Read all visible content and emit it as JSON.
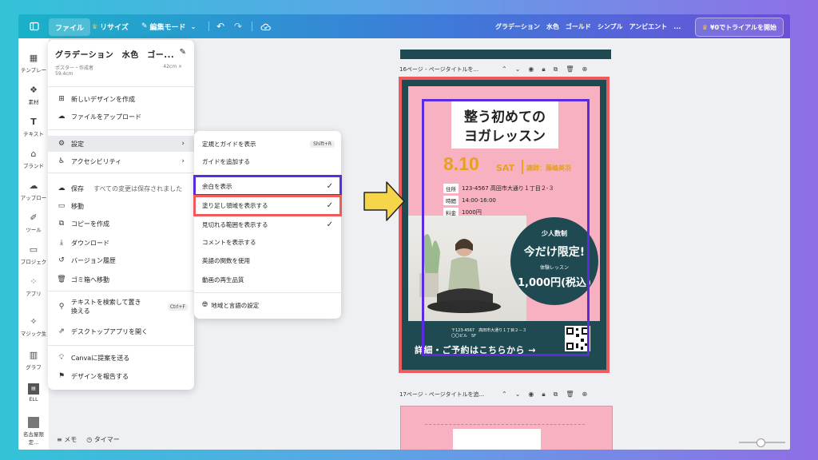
{
  "topbar": {
    "file": "ファイル",
    "resize": "リサイズ",
    "edit_mode": "編集モード",
    "doc_title": "グラデーション　水色　ゴールド　シンプル　アンビエント　...",
    "trial": "¥0でトライアルを開始"
  },
  "rail": [
    {
      "label": "テンプレー",
      "icon": "template-icon"
    },
    {
      "label": "素材",
      "icon": "elements-icon"
    },
    {
      "label": "テキスト",
      "icon": "text-icon"
    },
    {
      "label": "ブランド",
      "icon": "brand-icon"
    },
    {
      "label": "アップロー",
      "icon": "upload-icon"
    },
    {
      "label": "ツール",
      "icon": "tools-icon"
    },
    {
      "label": "プロジェク",
      "icon": "projects-icon"
    },
    {
      "label": "アプリ",
      "icon": "apps-icon"
    },
    {
      "label": "マジック生",
      "icon": "magic-icon"
    },
    {
      "label": "グラフ",
      "icon": "chart-icon"
    },
    {
      "label": "ELL",
      "icon": "ell-icon"
    },
    {
      "label": "名古屋限定...",
      "icon": "folder-icon"
    }
  ],
  "bottom": {
    "notes": "メモ",
    "timer": "タイマー"
  },
  "menu": {
    "title": "グラデーション　水色　ゴー...",
    "meta_left": "ポスター・作成者",
    "meta_right": "42cm ×",
    "meta_size": "59.4cm",
    "items": {
      "new_design": "新しいデザインを作成",
      "upload": "ファイルをアップロード",
      "settings": "設定",
      "accessibility": "アクセシビリティ",
      "save": "保存",
      "save_status": "すべての変更は保存されました",
      "move": "移動",
      "copy": "コピーを作成",
      "download": "ダウンロード",
      "version": "バージョン履歴",
      "trash": "ゴミ箱へ移動",
      "find_1": "テキストを検索して置き",
      "find_2": "換える",
      "find_shortcut": "Ctrl+F",
      "desktop": "デスクトップアプリを開く",
      "suggest": "Canvaに提案を送る",
      "report": "デザインを報告する"
    }
  },
  "submenu": {
    "rulers": "定規とガイドを表示",
    "rulers_shortcut": "Shift+R",
    "add_guide": "ガイドを追加する",
    "margins": "余白を表示",
    "bleed": "塗り足し領域を表示する",
    "cut": "見切れる範囲を表示する",
    "comments": "コメントを表示する",
    "english_fn": "英語の関数を使用",
    "video_quality": "動画の再生品質",
    "region": "地域と言語の設定"
  },
  "pages": {
    "p16": "16ページ - ページタイトルを...",
    "p17": "17ページ - ページタイトルを追..."
  },
  "poster": {
    "title_line1": "整う初めての",
    "title_line2": "ヨガレッスン",
    "date": "8.10",
    "day": "SAT",
    "lecturer": "講師：藤嶋美羽",
    "addr_tag": "住所",
    "addr": "123-4567 高田市大通り１丁目２-３",
    "time_tag": "時間",
    "time": "14:00-16:00",
    "fee_tag": "料金",
    "fee": "1000円",
    "circle_a": "少人数制",
    "circle_b": "今だけ限定!",
    "circle_c": "体験レッスン",
    "circle_d": "1,000円(税込)",
    "footer_small": "〒123-4567　高田市大通り１丁目２－３",
    "footer_small2": "〇〇ビル　5F",
    "footer_big": "詳細・ご予約はこちらから →"
  },
  "colors": {
    "highlight_purple": "#5b2be0",
    "highlight_red": "#ef5a5a",
    "arrow": "#f7d54a"
  }
}
